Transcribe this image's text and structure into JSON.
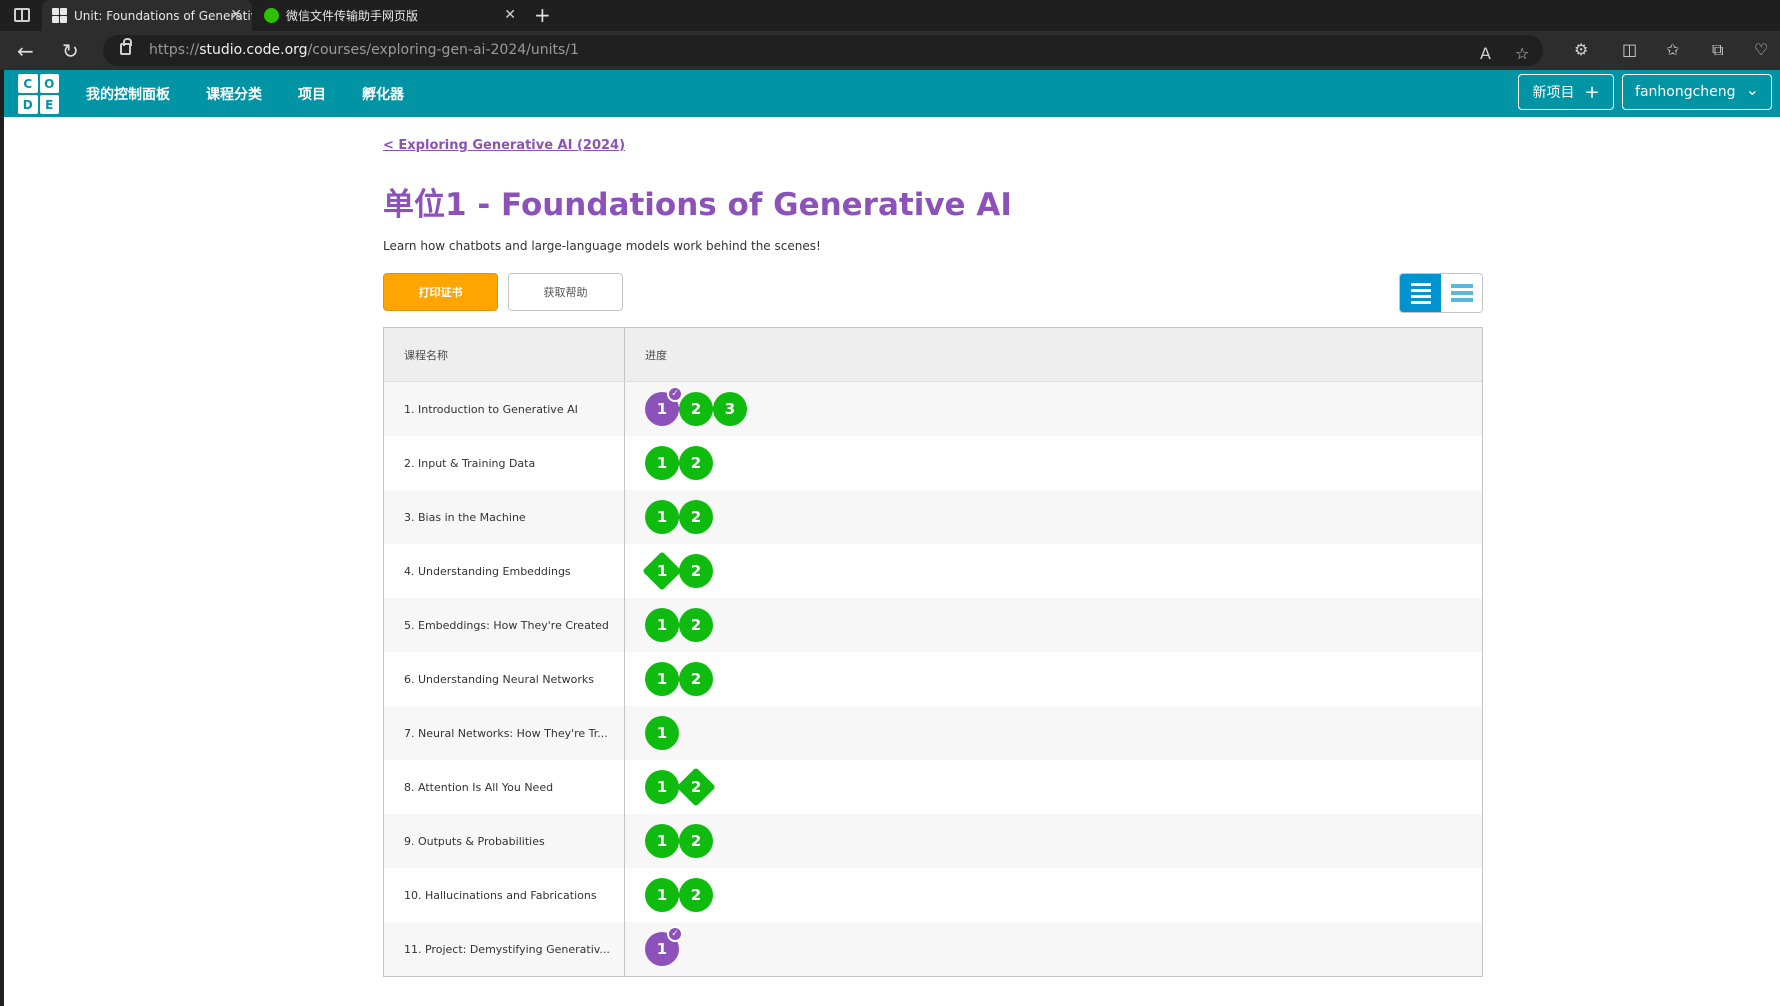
{
  "browser": {
    "tabs": [
      {
        "title": "Unit: Foundations of Generative AI",
        "active": true,
        "icon": "code-org-favicon"
      },
      {
        "title": "微信文件传输助手网页版",
        "active": false,
        "icon": "wechat-favicon"
      }
    ],
    "url_prefix": "https://",
    "url_domain": "studio.code.org",
    "url_path": "/courses/exploring-gen-ai-2024/units/1"
  },
  "header": {
    "logo_letters": [
      "C",
      "O",
      "D",
      "E"
    ],
    "nav": [
      "我的控制面板",
      "课程分类",
      "项目",
      "孵化器"
    ],
    "new_project": "新项目",
    "new_project_icon": "+",
    "user": "fanhongcheng",
    "user_icon": "⌄",
    "brand_color": "#0094a5"
  },
  "page": {
    "back_link": "< Exploring Generative AI (2024)",
    "title": "单位1 - Foundations of Generative AI",
    "description": "Learn how chatbots and large-language models work behind the scenes!",
    "print_certificate": "打印证书",
    "get_help": "获取帮助",
    "accent_color": "#8c52ba"
  },
  "table": {
    "col_lesson": "课程名称",
    "col_progress": "进度",
    "rows": [
      {
        "name": "1. Introduction to Generative AI",
        "levels": [
          {
            "n": "1",
            "kind": "circle",
            "state": "assessment-submitted"
          },
          {
            "n": "2",
            "kind": "circle",
            "state": "completed"
          },
          {
            "n": "3",
            "kind": "circle",
            "state": "completed"
          }
        ]
      },
      {
        "name": "2. Input & Training Data",
        "levels": [
          {
            "n": "1",
            "kind": "circle",
            "state": "completed"
          },
          {
            "n": "2",
            "kind": "circle",
            "state": "completed"
          }
        ]
      },
      {
        "name": "3. Bias in the Machine",
        "levels": [
          {
            "n": "1",
            "kind": "circle",
            "state": "completed"
          },
          {
            "n": "2",
            "kind": "circle",
            "state": "completed"
          }
        ]
      },
      {
        "name": "4. Understanding Embeddings",
        "levels": [
          {
            "n": "1",
            "kind": "diamond",
            "state": "completed"
          },
          {
            "n": "2",
            "kind": "circle",
            "state": "completed"
          }
        ]
      },
      {
        "name": "5. Embeddings: How They're Created",
        "levels": [
          {
            "n": "1",
            "kind": "circle",
            "state": "completed"
          },
          {
            "n": "2",
            "kind": "circle",
            "state": "completed"
          }
        ]
      },
      {
        "name": "6. Understanding Neural Networks",
        "levels": [
          {
            "n": "1",
            "kind": "circle",
            "state": "completed"
          },
          {
            "n": "2",
            "kind": "circle",
            "state": "completed"
          }
        ]
      },
      {
        "name": "7. Neural Networks: How They're Tr...",
        "levels": [
          {
            "n": "1",
            "kind": "circle",
            "state": "completed"
          }
        ]
      },
      {
        "name": "8. Attention Is All You Need",
        "levels": [
          {
            "n": "1",
            "kind": "circle",
            "state": "completed"
          },
          {
            "n": "2",
            "kind": "diamond",
            "state": "completed"
          }
        ]
      },
      {
        "name": "9. Outputs & Probabilities",
        "levels": [
          {
            "n": "1",
            "kind": "circle",
            "state": "completed"
          },
          {
            "n": "2",
            "kind": "circle",
            "state": "completed"
          }
        ]
      },
      {
        "name": "10. Hallucinations and Fabrications",
        "levels": [
          {
            "n": "1",
            "kind": "circle",
            "state": "completed"
          },
          {
            "n": "2",
            "kind": "circle",
            "state": "completed"
          }
        ]
      },
      {
        "name": "11. Project: Demystifying Generativ...",
        "levels": [
          {
            "n": "1",
            "kind": "circle",
            "state": "assessment-submitted"
          }
        ]
      }
    ],
    "completed_color": "#0ebb0e",
    "submitted_color": "#8c52ba"
  }
}
